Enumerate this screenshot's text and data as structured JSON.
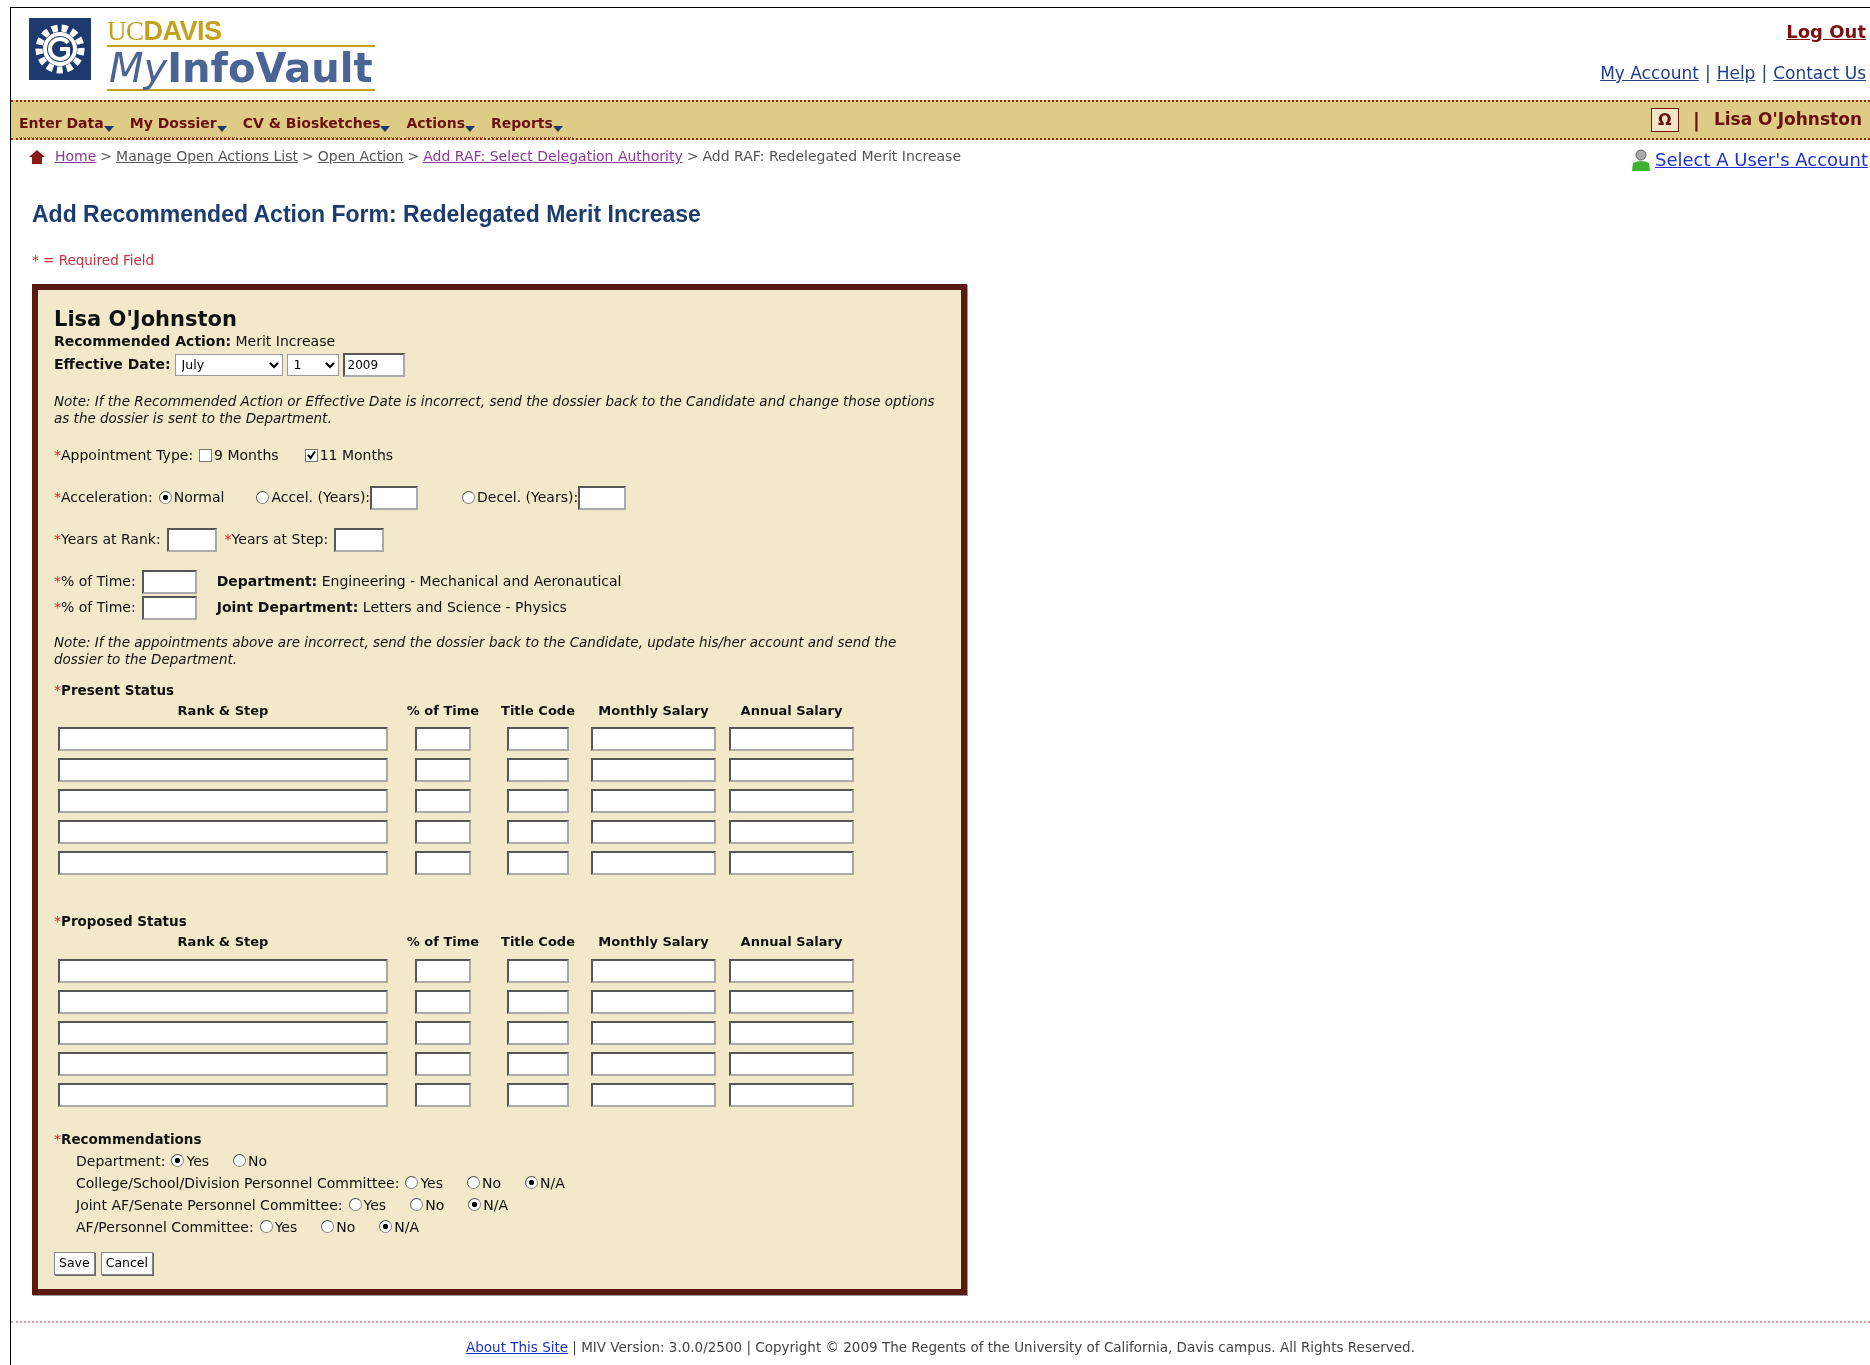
{
  "header": {
    "logo": {
      "top": "UC**DAVIS**",
      "name_italic": "My",
      "name_rest": "InfoVault"
    },
    "log_out": "Log Out",
    "links": [
      {
        "label": "My Account",
        "sep": "|"
      },
      {
        "label": "Help",
        "sep": "|"
      },
      {
        "label": "Contact Us"
      }
    ]
  },
  "nav": {
    "menus": [
      "Enter Data",
      "My Dossier",
      "CV & Biosketches",
      "Actions",
      "Reports"
    ],
    "symbol_button": "Ω",
    "separator": "|",
    "user": "Lisa O'Johnston"
  },
  "breadcrumb": {
    "items": [
      {
        "label": "Home",
        "link": true,
        "visited": true,
        "sep": ">"
      },
      {
        "label": "Manage Open Actions List",
        "link": true,
        "visited": false,
        "sep": ">"
      },
      {
        "label": "Open Action",
        "link": true,
        "visited": false,
        "sep": ">"
      },
      {
        "label": "Add RAF: Select Delegation Authority",
        "link": true,
        "visited": true,
        "sep": ">"
      },
      {
        "label": "Add RAF: Redelegated Merit Increase",
        "link": false,
        "visited": false
      }
    ],
    "select_account": "Select A User's Account"
  },
  "page_title": "Add Recommended Action Form: Redelegated Merit Increase",
  "required_note": "* = Required Field",
  "form": {
    "required_mark": "*",
    "name": "Lisa O'Johnston",
    "recommended_action": {
      "label": "Recommended Action:",
      "value": "Merit Increase"
    },
    "effective_date": {
      "label": "Effective Date:",
      "month": "July",
      "day": "1",
      "year": "2009"
    },
    "note_top": "Note: If the Recommended Action or Effective Date is incorrect, send the dossier back to the Candidate and change those options as the dossier is sent to the Department.",
    "appointment_type": {
      "label": "Appointment Type:",
      "required": true,
      "options": [
        {
          "label": "9 Months",
          "checked": false
        },
        {
          "label": "11 Months",
          "checked": true
        }
      ]
    },
    "acceleration": {
      "label": "Acceleration:",
      "required": true,
      "options": [
        {
          "label": "Normal",
          "selected": true,
          "kind": "plain"
        },
        {
          "label": "Accel. (Years):",
          "selected": false,
          "kind": "years"
        },
        {
          "label": "Decel. (Years):",
          "selected": false,
          "kind": "years"
        }
      ]
    },
    "years": [
      {
        "label": "Years at Rank:",
        "required": true
      },
      {
        "label": "Years at Step:",
        "required": true
      }
    ],
    "time": [
      {
        "label": "% of Time:",
        "required": true,
        "dept_label": "Department:",
        "dept_value": "Engineering - Mechanical and Aeronautical"
      },
      {
        "label": "% of Time:",
        "required": true,
        "dept_label": "Joint Department:",
        "dept_value": "Letters and Science - Physics"
      }
    ],
    "note_appointments": "Note: If the appointments above are incorrect, send the dossier back to the Candidate, update his/her account and send the dossier to the Department.",
    "status_tables": [
      {
        "title": "Present Status",
        "required": true,
        "columns": [
          "Rank & Step",
          "% of Time",
          "Title Code",
          "Monthly Salary",
          "Annual Salary"
        ]
      },
      {
        "title": "Proposed Status",
        "required": true,
        "columns": [
          "Rank & Step",
          "% of Time",
          "Title Code",
          "Monthly Salary",
          "Annual Salary"
        ]
      }
    ],
    "recommendations": {
      "title": "Recommendations",
      "required": true,
      "groups": [
        {
          "label": "Department:",
          "options": [
            {
              "label": "Yes",
              "selected": true
            },
            {
              "label": "No",
              "selected": false
            }
          ]
        },
        {
          "label": "College/School/Division Personnel Committee:",
          "options": [
            {
              "label": "Yes",
              "selected": false
            },
            {
              "label": "No",
              "selected": false
            },
            {
              "label": "N/A",
              "selected": true
            }
          ]
        },
        {
          "label": "Joint AF/Senate Personnel Committee:",
          "options": [
            {
              "label": "Yes",
              "selected": false
            },
            {
              "label": "No",
              "selected": false
            },
            {
              "label": "N/A",
              "selected": true
            }
          ]
        },
        {
          "label": "AF/Personnel Committee:",
          "options": [
            {
              "label": "Yes",
              "selected": false
            },
            {
              "label": "No",
              "selected": false
            },
            {
              "label": "N/A",
              "selected": true
            }
          ]
        }
      ]
    },
    "buttons": [
      "Save",
      "Cancel"
    ]
  },
  "footer": {
    "link": "About This Site",
    "text": "| MIV Version: 3.0.0/2500 | Copyright © 2009 The Regents of the University of California, Davis campus. All Rights Reserved."
  }
}
